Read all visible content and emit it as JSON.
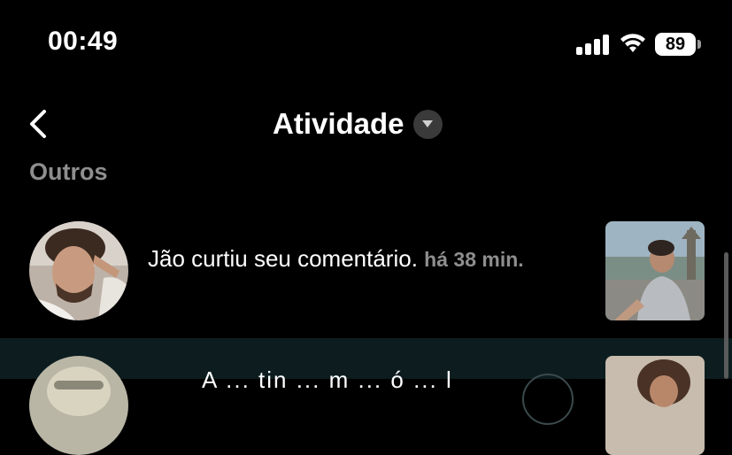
{
  "status_bar": {
    "time": "00:49",
    "battery": "89"
  },
  "header": {
    "title": "Atividade"
  },
  "section": {
    "label": "Outros"
  },
  "notifications": [
    {
      "text": "Jão curtiu seu comentário.",
      "time": "há 38 min."
    },
    {
      "text": "A ... tin ... m ... ó ... l"
    }
  ],
  "colors": {
    "background": "#000000",
    "secondary_text": "#8e8e8e",
    "highlight_row": "#0d1d1f"
  }
}
